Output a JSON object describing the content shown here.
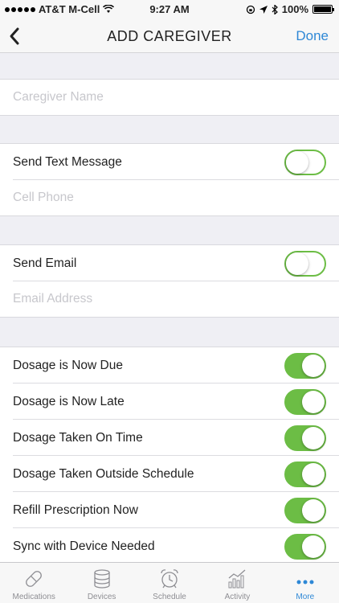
{
  "status": {
    "carrier": "AT&T M-Cell",
    "time": "9:27 AM",
    "battery": "100%",
    "battery_level": 1.0
  },
  "nav": {
    "back_icon": "chevron-left-icon",
    "title": "ADD CAREGIVER",
    "done": "Done"
  },
  "fields": {
    "caregiver_name": {
      "placeholder": "Caregiver Name",
      "value": ""
    },
    "send_text": {
      "label": "Send Text Message",
      "on": false
    },
    "cell_phone": {
      "placeholder": "Cell Phone",
      "value": ""
    },
    "send_email": {
      "label": "Send Email",
      "on": false
    },
    "email_address": {
      "placeholder": "Email Address",
      "value": ""
    }
  },
  "notifications": [
    {
      "label": "Dosage is Now Due",
      "on": true
    },
    {
      "label": "Dosage is Now Late",
      "on": true
    },
    {
      "label": "Dosage Taken On Time",
      "on": true
    },
    {
      "label": "Dosage Taken Outside Schedule",
      "on": true
    },
    {
      "label": "Refill Prescription Now",
      "on": true
    },
    {
      "label": "Sync with Device Needed",
      "on": true
    }
  ],
  "tabs": [
    {
      "label": "Medications",
      "icon": "pill-icon",
      "active": false
    },
    {
      "label": "Devices",
      "icon": "device-icon",
      "active": false
    },
    {
      "label": "Schedule",
      "icon": "alarm-clock-icon",
      "active": false
    },
    {
      "label": "Activity",
      "icon": "bar-chart-icon",
      "active": false
    },
    {
      "label": "More",
      "icon": "more-dots-icon",
      "active": true
    }
  ],
  "colors": {
    "accent": "#2e88d6",
    "toggle_on": "#6cbd45",
    "background": "#efeff4"
  }
}
